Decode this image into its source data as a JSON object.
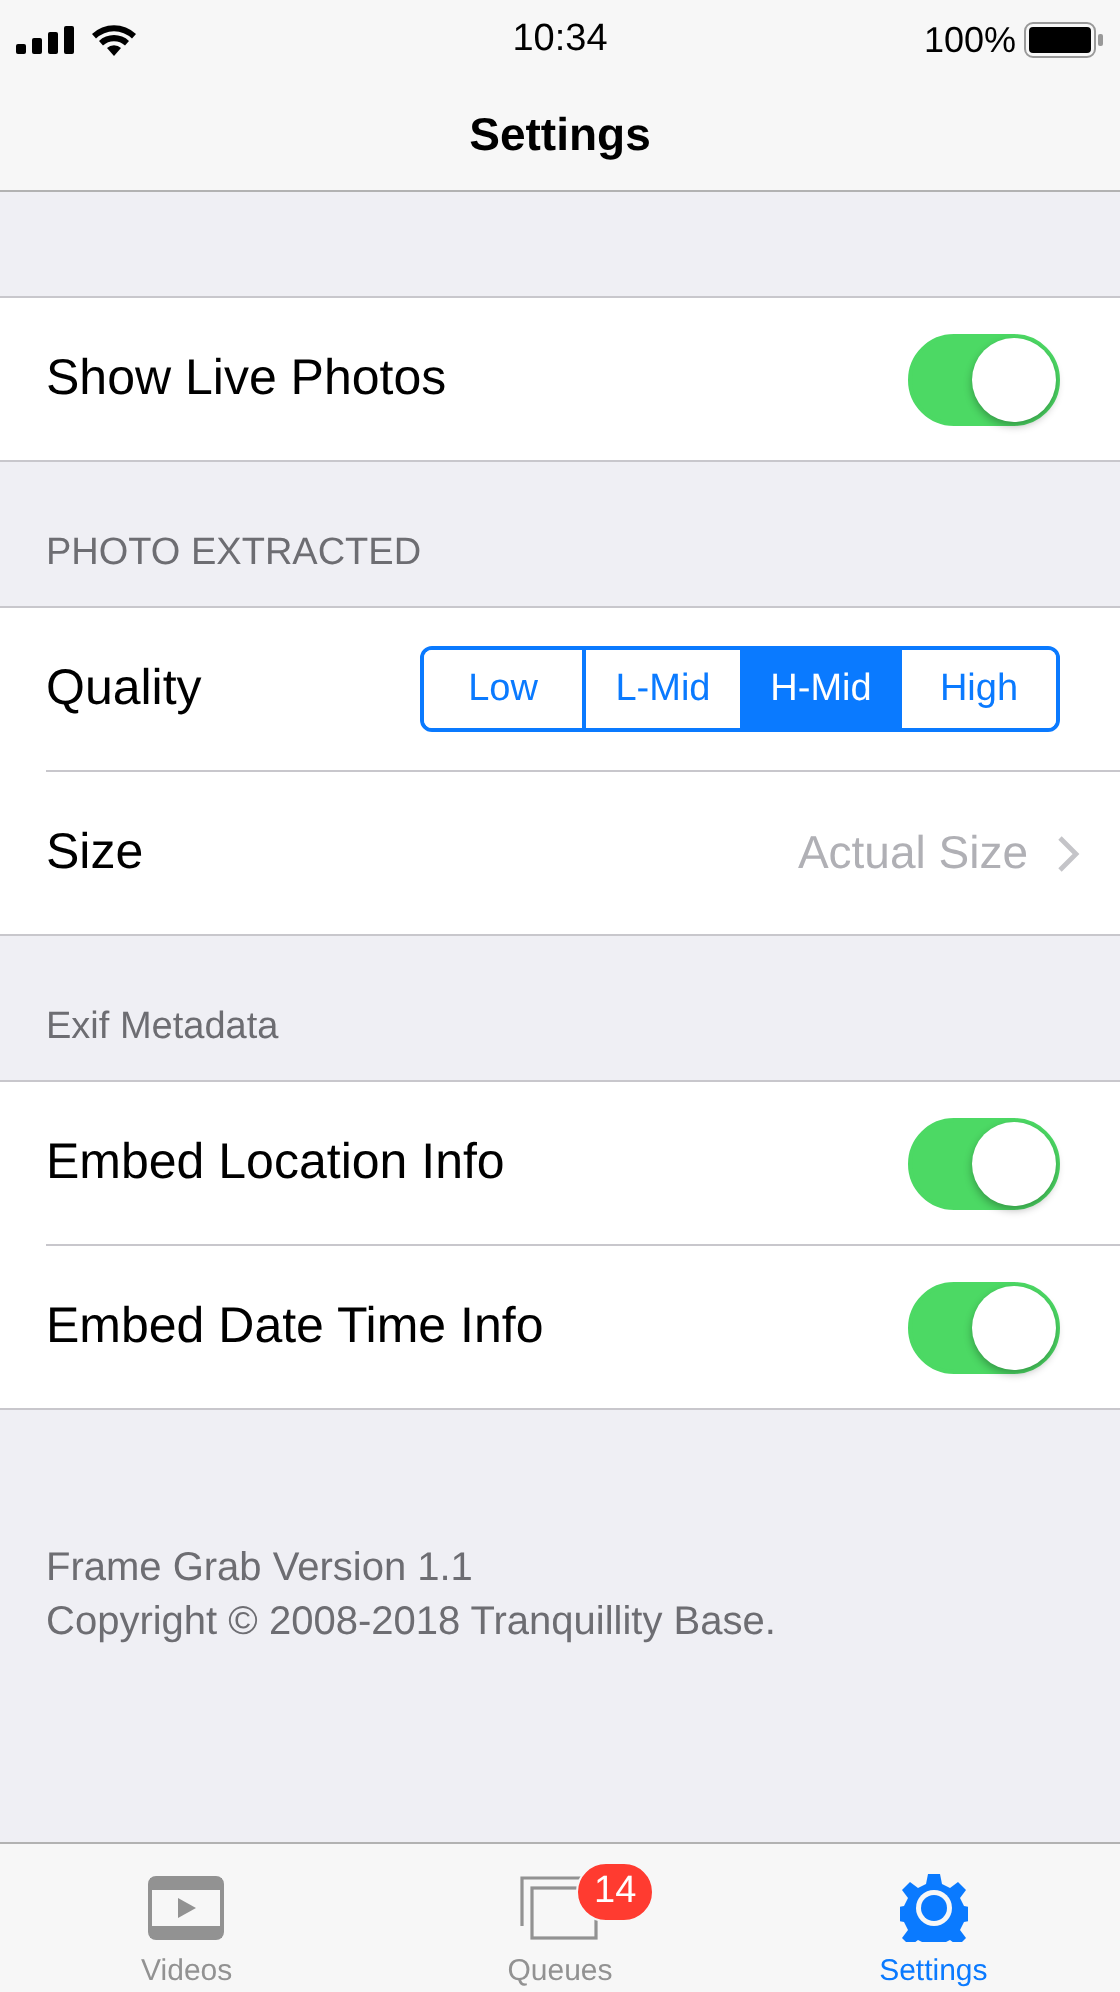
{
  "status_bar": {
    "time": "10:34",
    "battery": "100%"
  },
  "nav": {
    "title": "Settings"
  },
  "sections": [
    {
      "rows": [
        {
          "kind": "toggle",
          "label": "Show Live Photos",
          "on": true
        }
      ]
    },
    {
      "header": "PHOTO EXTRACTED",
      "rows": [
        {
          "kind": "segmented",
          "label": "Quality",
          "segments": [
            {
              "label": "Low",
              "selected": false
            },
            {
              "label": "L-Mid",
              "selected": false
            },
            {
              "label": "H-Mid",
              "selected": true
            },
            {
              "label": "High",
              "selected": false
            }
          ]
        },
        {
          "kind": "disclosure",
          "label": "Size",
          "value": "Actual Size"
        }
      ]
    },
    {
      "header": "Exif Metadata",
      "rows": [
        {
          "kind": "toggle",
          "label": "Embed Location Info",
          "on": true
        },
        {
          "kind": "toggle",
          "label": "Embed Date Time Info",
          "on": true
        }
      ]
    }
  ],
  "footer": [
    "Frame Grab Version 1.1",
    "Copyright © 2008-2018 Tranquillity Base."
  ],
  "tab_bar": [
    {
      "kind": "videos",
      "label": "Videos",
      "selected": false
    },
    {
      "kind": "queues",
      "label": "Queues",
      "selected": false,
      "badge": "14"
    },
    {
      "kind": "settings",
      "label": "Settings",
      "selected": true
    }
  ]
}
